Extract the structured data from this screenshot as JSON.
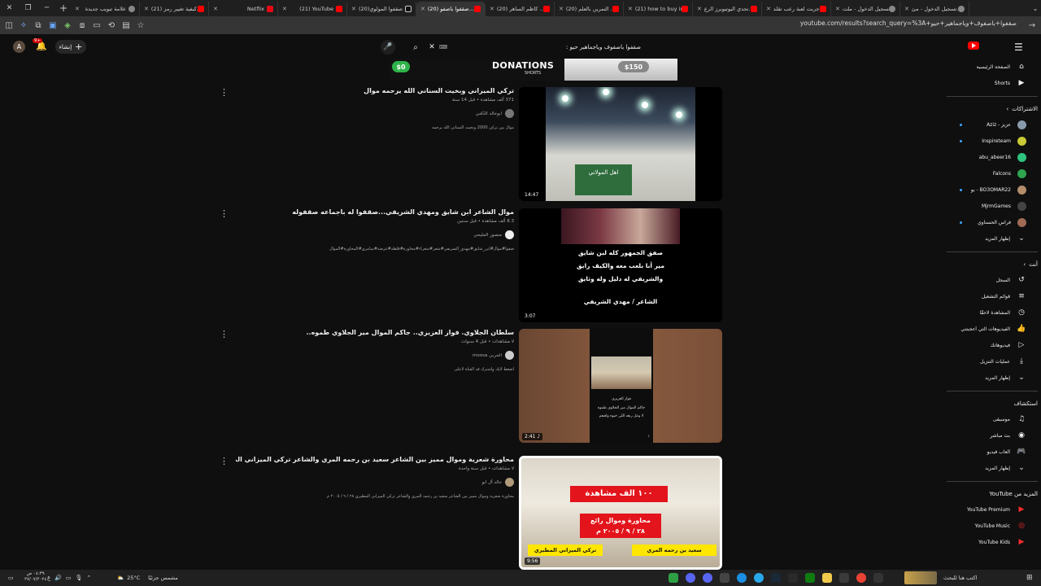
{
  "browser": {
    "tabs": [
      {
        "title": "تسجيل الدخول - مئ...",
        "icon": "google-account-icon",
        "active": false
      },
      {
        "title": "تسجيل الدخول - ملت...",
        "icon": "google-account-icon",
        "active": false
      },
      {
        "title": "جربت لعبة رعب تقلد...",
        "icon": "youtube-icon",
        "active": false
      },
      {
        "title": "تحدي اليوتيوبرز الرع...",
        "icon": "youtube-icon",
        "active": false
      },
      {
        "title": "(21) how to buy in...",
        "icon": "youtube-icon",
        "active": false
      },
      {
        "title": "(20) التمرين بالعلم ...",
        "icon": "youtube-icon",
        "active": false
      },
      {
        "title": "(20) كاظم الساهر ...",
        "icon": "youtube-icon",
        "active": false
      },
      {
        "title": "(20) صقفوا باصفو...",
        "icon": "youtube-icon",
        "active": true
      },
      {
        "title": "(20)صقفوا المولوي",
        "icon": "tiktok-icon",
        "active": false
      },
      {
        "title": "(21) YouTube",
        "icon": "youtube-icon",
        "active": false
      },
      {
        "title": "Netflix",
        "icon": "netflix-icon",
        "active": false
      },
      {
        "title": "(21) كيفية تغيير رمز...",
        "icon": "youtube-icon",
        "active": false
      },
      {
        "title": "علامة تبويب جديدة",
        "icon": "newtab-icon",
        "active": false
      }
    ],
    "url": "youtube.com/results?search_query=%3A+صقفوا+باصفوف+وياجماهير+حيو"
  },
  "masthead": {
    "avatar_letter": "A",
    "notifications_badge": "9+",
    "create_label": "إنشاء",
    "search_query": "صقفوا باصفوف وياجماهير حيو :"
  },
  "results": {
    "donation_banner": {
      "left_amount": "$0",
      "right_amount": "$150",
      "title": "DONATIONS",
      "subtitle": "SHORTS"
    },
    "videos": [
      {
        "title": "تركي الميزاني وبخيت السناني الله يرحمه موال",
        "stats": "371 ألف مشاهدة • قبل 14 سنة",
        "channel": "ابوخالد الدّقني",
        "description": "موال بين تركي 2000 وبخيت السناني الله يرحمه",
        "duration": "14:47",
        "thumb_text": "اهل المولاني"
      },
      {
        "title": "موال الشاعر ابن شايق ومهدي الشريفي...صقفوا له باجماعه صقفوله",
        "stats": "8.3 ألف مشاهدة • قبل سنتين",
        "channel": "منصور المليحي",
        "description": "صقوا#موال#ابن_شايق#مهدي_الشريفي#شعر#شعراء#محاورة#قلطة#عرضة#سامري#المحاورة#الموال",
        "duration": "3:07",
        "thumb_lines": [
          "صفق الجمهور كله لبن شايق",
          "مير أنا بلعب معه والكيف رايق",
          "والشريفي له دليل وله وثايق",
          "الشاعر / مهدي الشريفي"
        ]
      },
      {
        "title": "سلطان الجلاوي. فواز العزيزي.. جاكم الموال مير الجلاوي طموه..",
        "stats": "لا مشاهدات • قبل 4 سنوات",
        "channel": "الحربي moosa",
        "description": "اضغط لايك واشترك قد القناة لاعلى",
        "duration": "2:41",
        "thumb_caption": [
          "فواز العزيزي",
          "جاكم الموال مير الجلاوي طموه",
          "لا وعل ربعه اللي خبوه واقبعم"
        ]
      },
      {
        "title": "محاورة شعرية وموال مميز بين الشاعر سعيد بن رحمه المري والشاعر تركي الميزاني المطيري ٢٨ / ٩ / ٢٠٠٥ م",
        "stats": "لا مشاهدات • قبل سنة واحدة",
        "channel": "خالد آل ابو",
        "description": "محاورة شعرية وموال مميز بين الشاعر سعيد بن رحمه المري والشاعر تركي الميزاني المطيري ٢٨ / ٩ / ٢٠٠٥ م",
        "duration": "9:56",
        "thumb_views": "١٠٠ الف مشاهدة",
        "thumb_title": "محاورة وموال رائع",
        "thumb_date": "٢٨ / ٩ / ٢٠٠٥ م",
        "thumb_left_name": "تركي الميزاني المطيري",
        "thumb_right_name": "سعيد بن رحمه المري"
      }
    ]
  },
  "guide": {
    "main": [
      {
        "label": "الصفحة الرئيسية",
        "icon": "home-icon"
      },
      {
        "label": "Shorts",
        "icon": "shorts-icon"
      }
    ],
    "subs_header": "الاشتراكات",
    "subscriptions": [
      {
        "label": "عزيز - Aziz",
        "color": "#8899aa",
        "dot": true
      },
      {
        "label": "Inspireteam",
        "color": "#c9c935",
        "dot": true
      },
      {
        "label": "abu_abeer16",
        "color": "#2ec27e",
        "dot": false
      },
      {
        "label": "Falcons",
        "color": "#2ea44f",
        "dot": false
      },
      {
        "label": "BO3OMAR22 - بو",
        "color": "#b58d6a",
        "dot": true
      },
      {
        "label": "MjrmGames",
        "color": "#444444",
        "dot": false
      },
      {
        "label": "فراس الحسناوي",
        "color": "#a06a54",
        "dot": true
      }
    ],
    "subs_more": "إظهار المزيد",
    "you_header": "أنت",
    "you": [
      {
        "label": "السجل",
        "icon": "history-icon"
      },
      {
        "label": "قوائم التشغيل",
        "icon": "playlist-icon"
      },
      {
        "label": "المشاهدة لاحقًا",
        "icon": "clock-icon"
      },
      {
        "label": "الفيديوهات التي أعجبتني",
        "icon": "like-icon"
      },
      {
        "label": "فيديوهاتك",
        "icon": "video-icon"
      },
      {
        "label": "عمليات التنزيل",
        "icon": "download-icon"
      },
      {
        "label": "إظهار المزيد",
        "icon": "chevron-down-icon"
      }
    ],
    "explore_header": "استكشاف",
    "explore": [
      {
        "label": "موسيقى",
        "icon": "music-icon"
      },
      {
        "label": "بث مباشر",
        "icon": "live-icon"
      },
      {
        "label": "ألعاب فيديو",
        "icon": "gaming-icon"
      },
      {
        "label": "إظهار المزيد",
        "icon": "chevron-down-icon"
      }
    ],
    "more_header": "المزيد من YouTube",
    "more": [
      {
        "label": "YouTube Premium",
        "icon": "premium-icon"
      },
      {
        "label": "YouTube Music",
        "icon": "ytmusic-icon"
      },
      {
        "label": "YouTube Kids",
        "icon": "ytkids-icon"
      }
    ]
  },
  "taskbar": {
    "time": "٠٤:٣٩ ص",
    "date": "٢٧/٠٧/٢٠٢٤",
    "weather": "25°C",
    "weather_text": "مشمس جزئيًا",
    "search_placeholder": "اكتب هنا للبحث"
  }
}
